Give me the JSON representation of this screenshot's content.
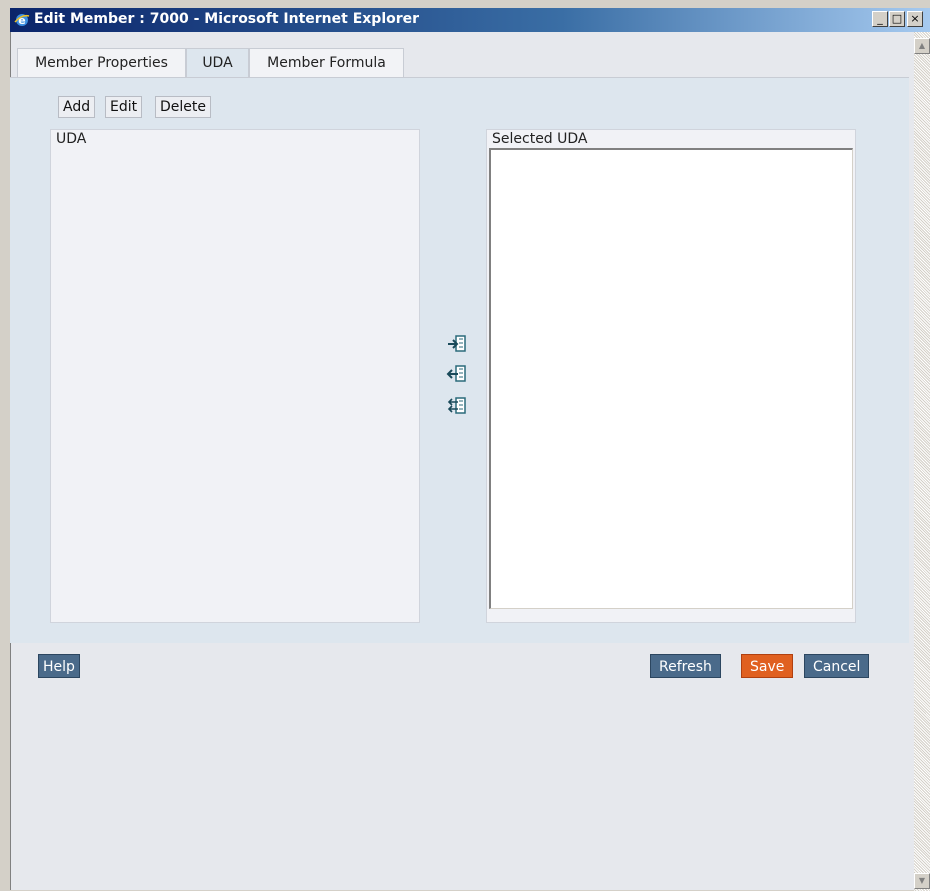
{
  "window": {
    "title": "Edit Member : 7000 - Microsoft Internet Explorer",
    "controls": {
      "minimize": "_",
      "maximize": "□",
      "close": "×"
    }
  },
  "tabs": [
    {
      "label": "Member Properties",
      "active": false
    },
    {
      "label": "UDA",
      "active": true
    },
    {
      "label": "Member Formula",
      "active": false
    }
  ],
  "uda_toolbar": {
    "add_label": "Add",
    "edit_label": "Edit",
    "delete_label": "Delete"
  },
  "uda_list": {
    "header": "UDA",
    "items": []
  },
  "selected_uda_list": {
    "header": "Selected UDA",
    "items": []
  },
  "move_buttons": {
    "add_icon": "move-right-icon",
    "remove_icon": "move-left-icon",
    "remove_all_icon": "move-all-left-icon"
  },
  "footer": {
    "help_label": "Help",
    "refresh_label": "Refresh",
    "save_label": "Save",
    "cancel_label": "Cancel"
  },
  "colors": {
    "titlebar_start": "#0a246a",
    "panel_bg": "#dde6ee",
    "button_bg": "#4a6a8a",
    "save_accent": "#e06020"
  }
}
